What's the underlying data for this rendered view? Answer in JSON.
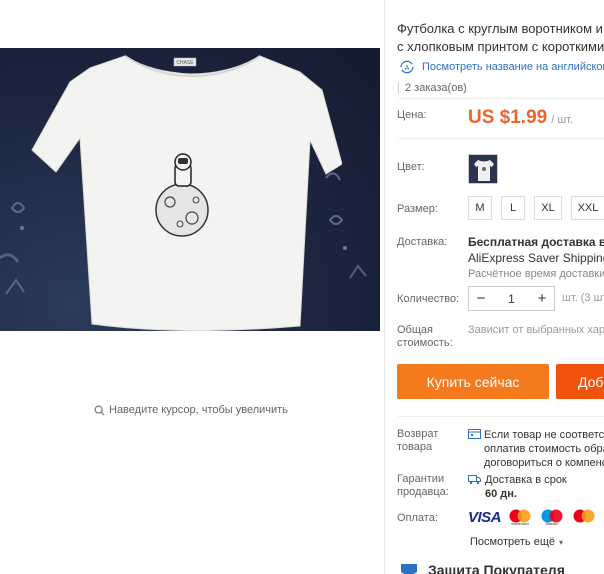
{
  "product": {
    "title_line1": "Футболка с круглым воротником и",
    "title_line2": "с хлопковым принтом с короткими",
    "translate_link": "Посмотреть название на английском",
    "orders": "2 заказа(ов)",
    "zoom_hint": "Наведите курсор, чтобы увеличить",
    "logo_text": "CHASE"
  },
  "labels": {
    "price": "Цена:",
    "color": "Цвет:",
    "size": "Размер:",
    "shipping": "Доставка:",
    "quantity": "Количество:",
    "total_line1": "Общая",
    "total_line2": "стоимость:",
    "return_line1": "Возврат",
    "return_line2": "товара",
    "guarantee_line1": "Гарантии",
    "guarantee_line2": "продавца:",
    "payment": "Оплата:"
  },
  "price": {
    "amount": "US $1.99",
    "unit": "/ шт."
  },
  "sizes": [
    "M",
    "L",
    "XL",
    "XXL"
  ],
  "shipping": {
    "free": "Бесплатная доставка в Ru",
    "method": "AliExpress Saver Shipping",
    "eta": "Расчётное время доставки:"
  },
  "quantity": {
    "minus": "−",
    "value": "1",
    "plus": "+",
    "note": "шт. (3 шт"
  },
  "total_note": "Зависит от выбранных хара",
  "buttons": {
    "buy": "Купить сейчас",
    "cart": "Доб"
  },
  "protection": {
    "line1": "Если товар не соответств",
    "line2": "оплатив стоимость обра",
    "line3": "договориться о компенс"
  },
  "guarantee": {
    "line1": "Доставка в срок",
    "line2": "60 дн."
  },
  "payment": {
    "visa": "VISA",
    "mastercard": "mastercard",
    "maestro": "Maestro",
    "more_brand": "MI"
  },
  "more_link": "Посмотреть ещё",
  "bottom_heading": "Защита Покупателя",
  "colors": {
    "accent_orange": "#f57a1d",
    "cart_orange": "#f0530b",
    "price_orange": "#f0632b",
    "link_blue": "#2b71c4"
  }
}
